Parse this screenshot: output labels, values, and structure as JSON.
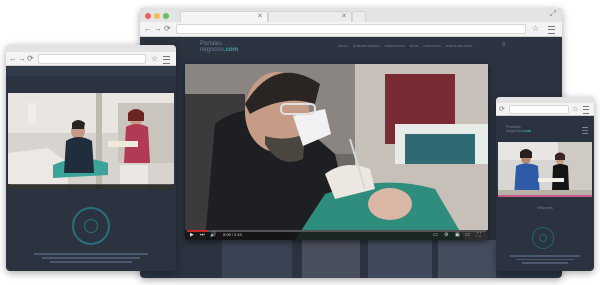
{
  "desktop": {
    "tab_title": "",
    "nav": {
      "back": "←",
      "forward": "→",
      "reload": "⟳",
      "star": "☆"
    },
    "site": {
      "logo_top": "Portales",
      "logo_bottom": "negocios",
      "logo_suffix": ".com",
      "links": [
        "INICIO",
        "QUIENES SOMOS",
        "PRODUCTOS",
        "BLOG",
        "CONTACTO",
        "OTROS ENLACES"
      ]
    },
    "video": {
      "time": "0:09 / 2:10",
      "progress": 0.07
    }
  },
  "laptop": {
    "nav": {
      "back": "←",
      "forward": "→",
      "reload": "⟳",
      "star": "☆"
    },
    "video": {
      "progress": 0.0
    }
  },
  "mobile": {
    "nav": {
      "reload": "⟳",
      "star": "☆"
    },
    "site": {
      "logo_top": "Portales",
      "logo_bottom": "negocios",
      "logo_suffix": ".com"
    },
    "section_title": "Misiones"
  },
  "colors": {
    "accent": "#3da6a6",
    "site_bg": "#2b3340",
    "progress": "#c62828"
  }
}
